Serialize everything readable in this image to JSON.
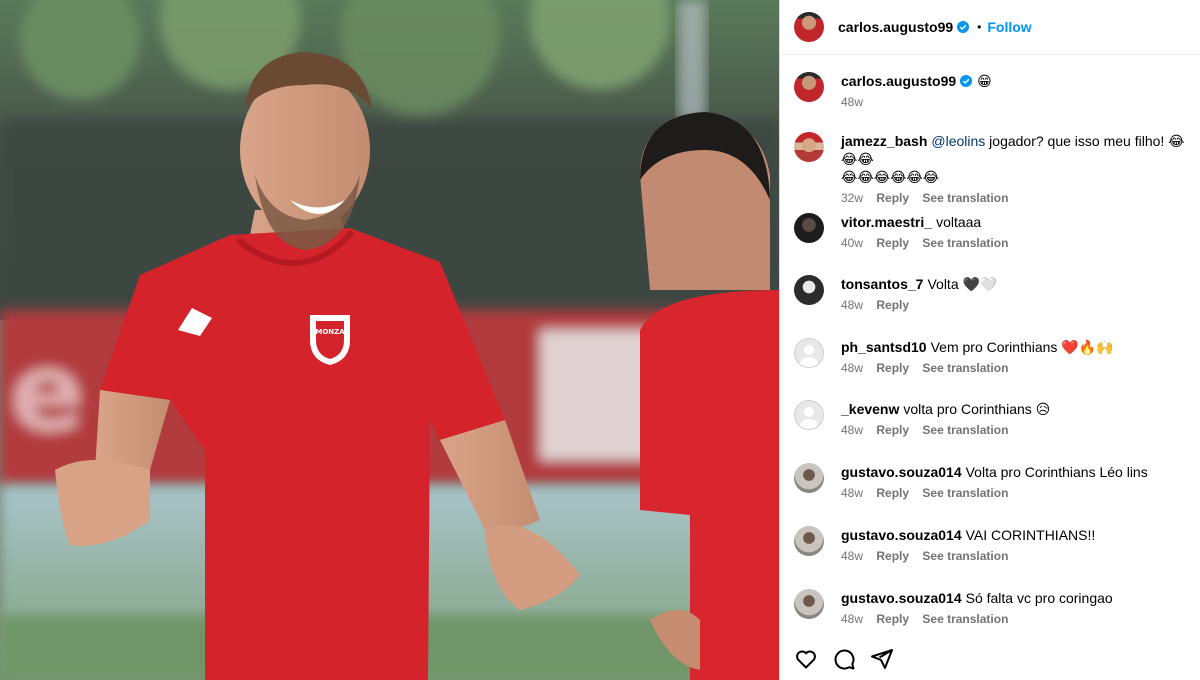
{
  "post": {
    "owner": "carlos.augusto99",
    "follow_label": "Follow",
    "separator": "•"
  },
  "caption": {
    "user": "carlos.augusto99",
    "text": "😁",
    "time": "48w"
  },
  "comments": [
    {
      "user": "jamezz_bash",
      "mention": "@leolins",
      "text": " jogador? que isso meu filho! ",
      "emoji_line1": "😂😂😂",
      "emoji_line2": "😂😂😂😂😂😂",
      "time": "32w",
      "reply": "Reply",
      "translate": "See translation"
    },
    {
      "user": "vitor.maestri_",
      "text": "voltaaa",
      "time": "40w",
      "reply": "Reply",
      "translate": "See translation"
    },
    {
      "user": "tonsantos_7",
      "text": "Volta 🖤🤍",
      "time": "48w",
      "reply": "Reply"
    },
    {
      "user": "ph_santsd10",
      "text": "Vem pro Corinthians ❤️🔥🙌",
      "time": "48w",
      "reply": "Reply",
      "translate": "See translation"
    },
    {
      "user": "_kevenw",
      "text": "volta pro Corinthians 😥",
      "time": "48w",
      "reply": "Reply",
      "translate": "See translation"
    },
    {
      "user": "gustavo.souza014",
      "text": "Volta pro Corinthians Léo lins",
      "time": "48w",
      "reply": "Reply",
      "translate": "See translation"
    },
    {
      "user": "gustavo.souza014",
      "text": "VAI CORINTHIANS!!",
      "time": "48w",
      "reply": "Reply",
      "translate": "See translation"
    },
    {
      "user": "gustavo.souza014",
      "text": "Só falta vc pro coringao",
      "time": "48w",
      "reply": "Reply",
      "translate": "See translation"
    }
  ],
  "photo": {
    "badge_text": "MONZA"
  },
  "icons": [
    "verified-badge-icon",
    "heart-icon",
    "comment-icon",
    "share-icon"
  ],
  "colors": {
    "accent": "#0095f6",
    "jersey": "#d4232b",
    "muted": "#737373"
  }
}
